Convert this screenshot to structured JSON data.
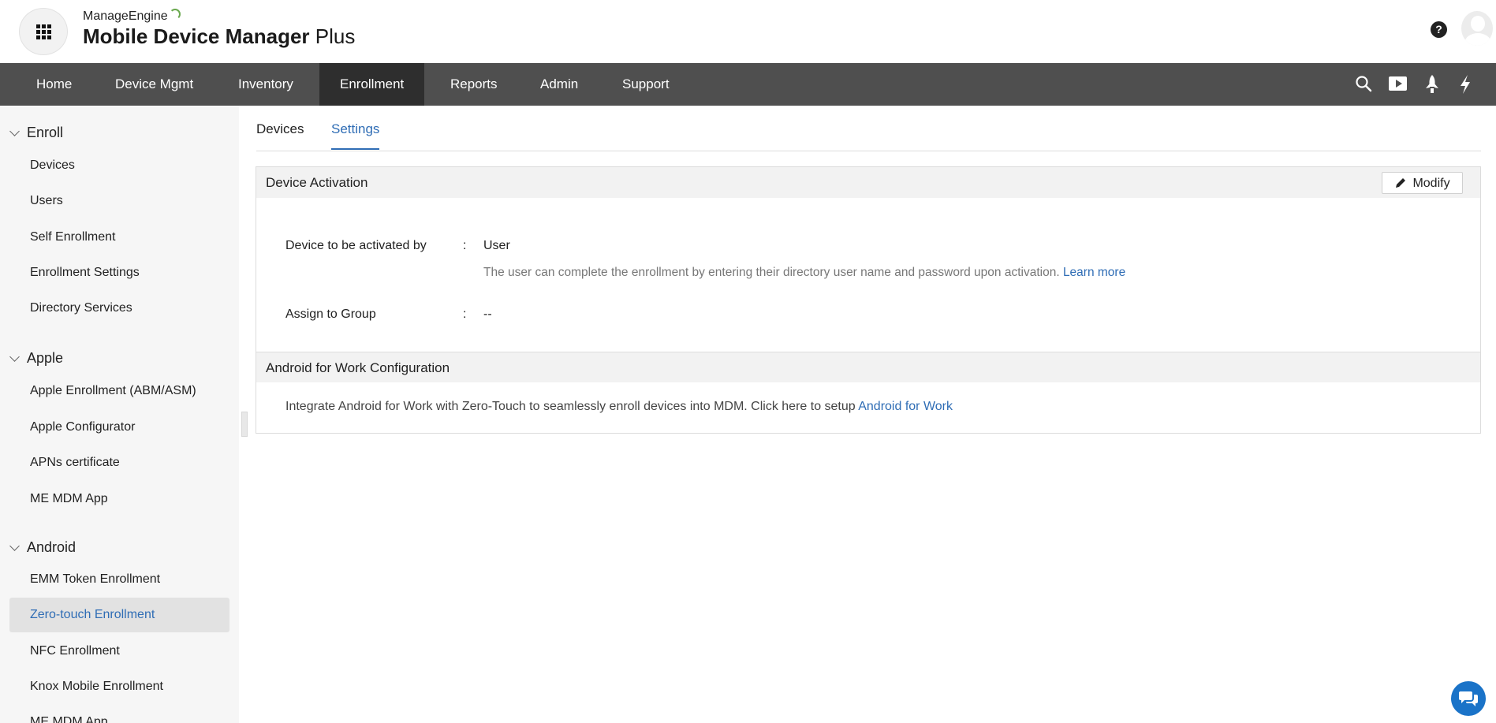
{
  "header": {
    "brand_small": "ManageEngine",
    "brand_product": "Mobile Device Manager",
    "brand_plus": "Plus",
    "help_glyph": "?"
  },
  "nav": {
    "items": [
      {
        "label": "Home"
      },
      {
        "label": "Device Mgmt"
      },
      {
        "label": "Inventory"
      },
      {
        "label": "Enrollment"
      },
      {
        "label": "Reports"
      },
      {
        "label": "Admin"
      },
      {
        "label": "Support"
      }
    ],
    "active": "Enrollment",
    "icons": [
      "search-icon",
      "video-icon",
      "rocket-icon",
      "lightning-icon"
    ]
  },
  "sidebar": {
    "sections": [
      {
        "title": "Enroll",
        "items": [
          "Devices",
          "Users",
          "Self Enrollment",
          "Enrollment Settings",
          "Directory Services"
        ]
      },
      {
        "title": "Apple",
        "items": [
          "Apple Enrollment (ABM/ASM)",
          "Apple Configurator",
          "APNs certificate",
          "ME MDM App"
        ]
      },
      {
        "title": "Android",
        "items": [
          "EMM Token Enrollment",
          "Zero-touch Enrollment",
          "NFC Enrollment",
          "Knox Mobile Enrollment",
          "ME MDM App"
        ]
      }
    ],
    "active_item": "Zero-touch Enrollment"
  },
  "tabs": {
    "items": [
      "Devices",
      "Settings"
    ],
    "active": "Settings"
  },
  "device_activation": {
    "title": "Device Activation",
    "modify_label": "Modify",
    "activated_by_label": "Device to be activated by",
    "colon": ":",
    "activated_by_value": "User",
    "activated_by_desc": "The user can complete the enrollment by entering their directory user name and password upon activation.",
    "learn_more": "Learn more",
    "assign_group_label": "Assign to Group",
    "assign_group_value": "--"
  },
  "android_for_work": {
    "title": "Android for Work Configuration",
    "text": "Integrate Android for Work with Zero-Touch to seamlessly enroll devices into MDM. Click here to setup",
    "link": "Android for Work"
  },
  "colors": {
    "nav_bg": "#4f4f4f",
    "nav_active_bg": "#2e2e2e",
    "accent": "#2f6db5",
    "sidebar_bg": "#f6f6f6",
    "chat_button": "#1a73c8"
  }
}
